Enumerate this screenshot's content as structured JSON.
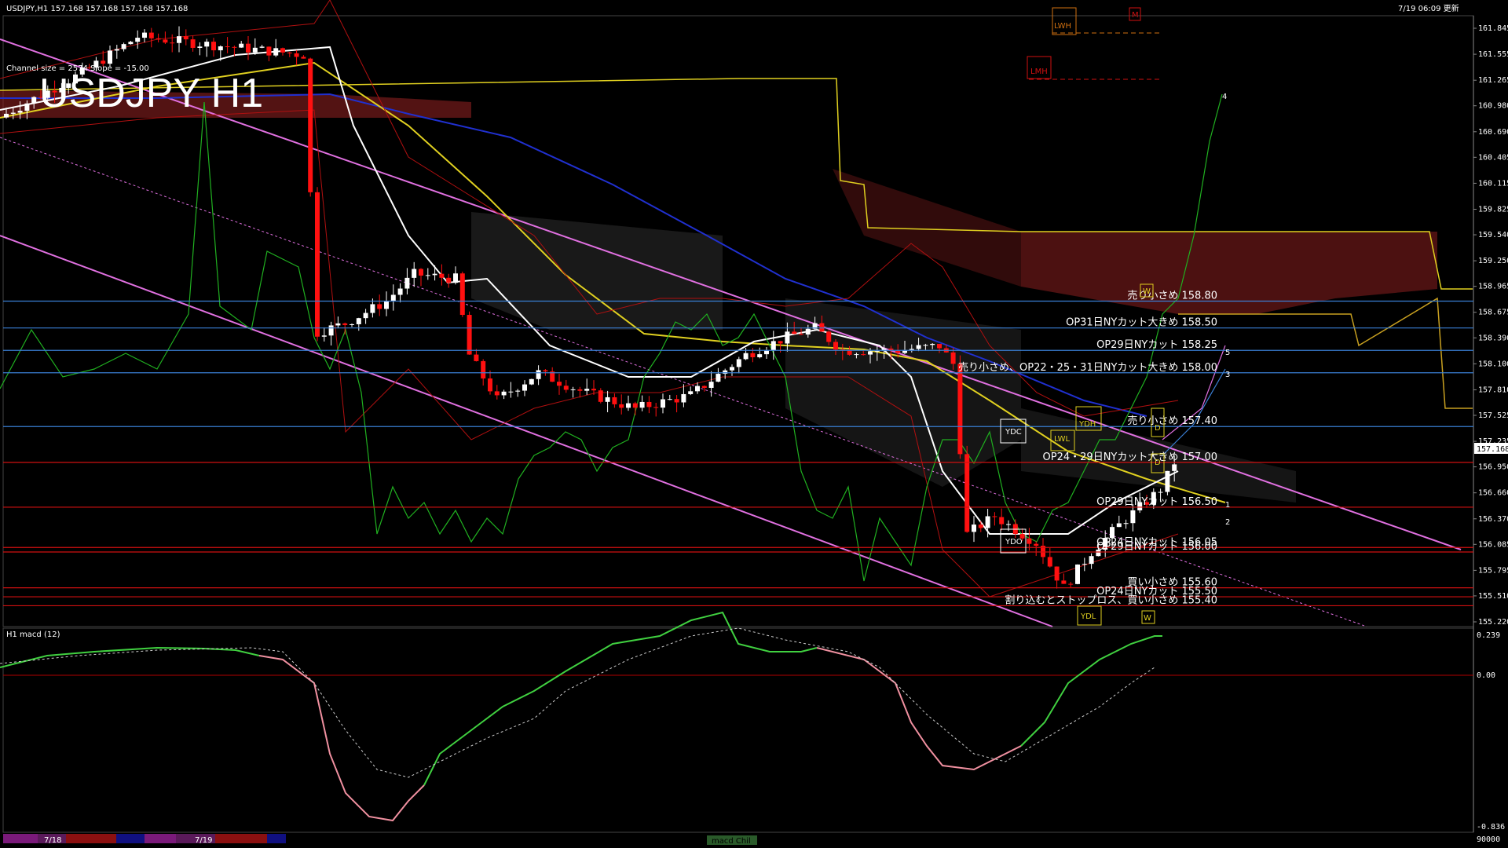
{
  "header": {
    "symbol_info": "USDJPY,H1  157.168 157.168 157.168 157.168",
    "timestamp": "7/19 06:09 更新",
    "big_title": "USDJPY H1",
    "channel_info": "Channel size = 2574 Slope = -15.00"
  },
  "price_axis": {
    "ticks": [
      "161.845",
      "161.555",
      "161.265",
      "160.980",
      "160.690",
      "160.405",
      "160.115",
      "159.825",
      "159.540",
      "159.250",
      "158.965",
      "158.675",
      "158.390",
      "158.100",
      "157.810",
      "157.525",
      "157.235",
      "156.950",
      "156.660",
      "156.370",
      "156.085",
      "155.795",
      "155.510",
      "155.220"
    ],
    "current_price": "157.168",
    "range": [
      155.22,
      161.845
    ]
  },
  "macd_panel": {
    "label": "H1  macd (12)",
    "top_value": "0.239",
    "zero_value": "0.00",
    "bottom_value": "-0.836",
    "volume_value": "90000",
    "range": [
      -0.836,
      0.239
    ]
  },
  "levels": [
    {
      "text": "売り小さめ 158.80",
      "price": 158.8,
      "color": "#3a7fd5"
    },
    {
      "text": "OP31日NYカット大きめ 158.50",
      "price": 158.5,
      "color": "#3a7fd5"
    },
    {
      "text": "OP29日NYカット 158.25",
      "price": 158.25,
      "color": "#3a7fd5"
    },
    {
      "text": "売り小さめ、OP22・25・31日NYカット大きめ 158.00",
      "price": 158.0,
      "color": "#3a7fd5"
    },
    {
      "text": "売り小さめ 157.40",
      "price": 157.4,
      "color": "#3a7fd5"
    },
    {
      "text": "OP24・29日NYカット大きめ 157.00",
      "price": 157.0,
      "color": "#d01010"
    },
    {
      "text": "OP29日NYカット 156.50",
      "price": 156.5,
      "color": "#d01010"
    },
    {
      "text": "OP24日NYカット 156.05",
      "price": 156.05,
      "color": "#d01010"
    },
    {
      "text": "OP29日NYカット 156.00",
      "price": 156.0,
      "color": "#d01010"
    },
    {
      "text": "買い小さめ 155.60",
      "price": 155.6,
      "color": "#d01010"
    },
    {
      "text": "OP24日NYカット 155.50",
      "price": 155.5,
      "color": "#d01010"
    },
    {
      "text": "割り込むとストップロス、買い小さめ 155.40",
      "price": 155.4,
      "color": "#d01010"
    }
  ],
  "markers": {
    "lwh": "LWH",
    "lmh": "LMH",
    "m": "M",
    "ydc": "YDC",
    "ydh": "YDH",
    "lwl": "LWL",
    "ydo": "YDO",
    "ydl": "YDL",
    "w": "W",
    "d": "D",
    "wave_labels": [
      "4",
      "5",
      "3",
      "1",
      "2"
    ]
  },
  "bottom_bar": {
    "date_labels": [
      "7/18",
      "7/19"
    ],
    "tab": "macd Chil"
  },
  "colors": {
    "blue_level": "#3a7fd5",
    "red_level": "#d01010",
    "channel": "#e070e0",
    "cloud": "#8b1f1f",
    "ma_white": "#ffffff",
    "ma_yellow": "#e0d020",
    "ma_blue": "#2030d0",
    "rsi": "#20b020",
    "bollinger": "#b01010",
    "macd_main": "#40d040",
    "macd_neg": "#f090a0"
  },
  "chart_data": {
    "type": "candlestick",
    "title": "USDJPY H1",
    "ylim": [
      155.22,
      161.845
    ],
    "close_path": [
      {
        "x": 0,
        "y": 160.85
      },
      {
        "x": 6,
        "y": 161.1
      },
      {
        "x": 12,
        "y": 161.35
      },
      {
        "x": 16,
        "y": 161.55
      },
      {
        "x": 20,
        "y": 161.75
      },
      {
        "x": 26,
        "y": 161.7
      },
      {
        "x": 32,
        "y": 161.65
      },
      {
        "x": 38,
        "y": 161.6
      },
      {
        "x": 44,
        "y": 161.55
      },
      {
        "x": 46,
        "y": 158.45
      },
      {
        "x": 50,
        "y": 158.55
      },
      {
        "x": 56,
        "y": 158.8
      },
      {
        "x": 60,
        "y": 159.1
      },
      {
        "x": 66,
        "y": 159.05
      },
      {
        "x": 68,
        "y": 158.2
      },
      {
        "x": 72,
        "y": 157.7
      },
      {
        "x": 78,
        "y": 158.0
      },
      {
        "x": 84,
        "y": 157.8
      },
      {
        "x": 92,
        "y": 157.6
      },
      {
        "x": 100,
        "y": 157.75
      },
      {
        "x": 108,
        "y": 158.2
      },
      {
        "x": 114,
        "y": 158.4
      },
      {
        "x": 118,
        "y": 158.5
      },
      {
        "x": 122,
        "y": 158.25
      },
      {
        "x": 126,
        "y": 158.25
      },
      {
        "x": 130,
        "y": 158.25
      },
      {
        "x": 124,
        "y": 158.3
      },
      {
        "x": 126,
        "y": 158.1
      },
      {
        "x": 128,
        "y": 156.2
      },
      {
        "x": 132,
        "y": 156.4
      },
      {
        "x": 138,
        "y": 156.1
      },
      {
        "x": 142,
        "y": 155.6
      },
      {
        "x": 146,
        "y": 156.0
      },
      {
        "x": 150,
        "y": 156.3
      },
      {
        "x": 156,
        "y": 156.7
      },
      {
        "x": 160,
        "y": 157.3
      },
      {
        "x": 166,
        "y": 157.168
      }
    ]
  }
}
